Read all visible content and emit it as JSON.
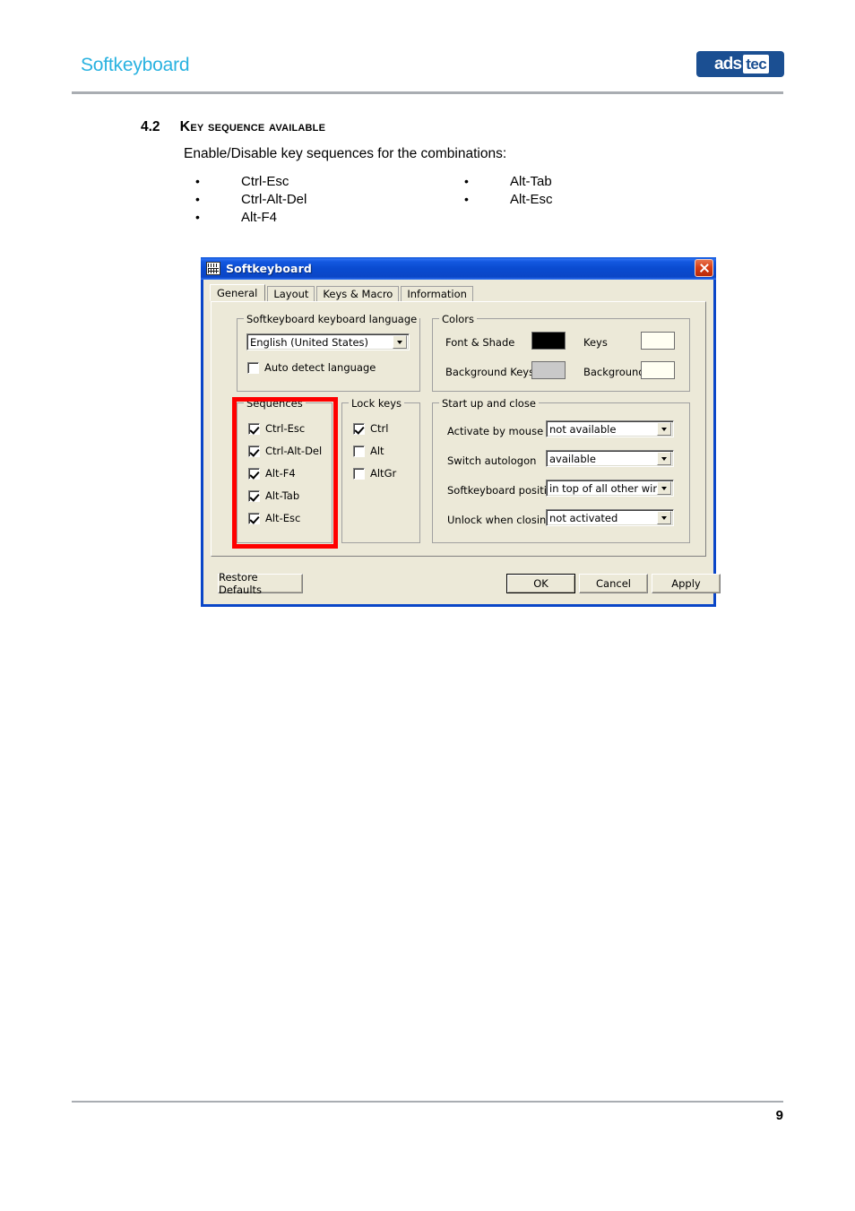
{
  "page": {
    "header_title": "Softkeyboard",
    "logo": {
      "part1": "ads",
      "part2": "tec"
    },
    "page_number": "9",
    "accent_color": "#29b2e0",
    "logo_color": "#1b4f92",
    "rule_color": "#a9adb2"
  },
  "section": {
    "number": "4.2",
    "title": "Key sequence available",
    "intro": "Enable/Disable key sequences for the combinations:",
    "bullets_left": [
      "Ctrl-Esc",
      "Ctrl-Alt-Del",
      "Alt-F4"
    ],
    "bullets_right": [
      "Alt-Tab",
      "Alt-Esc"
    ],
    "bullet_glyph": "•"
  },
  "dialog": {
    "title": "Softkeyboard",
    "icon": "keyboard-icon",
    "close_icon": "close-icon",
    "highlight_color": "#ff0000",
    "titlebar_color": "#0a4bd0",
    "face_color": "#ece9d8",
    "tabs": [
      {
        "label": "General",
        "active": true
      },
      {
        "label": "Layout",
        "active": false
      },
      {
        "label": "Keys & Macro",
        "active": false
      },
      {
        "label": "Information",
        "active": false
      }
    ],
    "language_group": {
      "title": "Softkeyboard keyboard language",
      "combo_value": "English (United States)",
      "auto_detect_label": "Auto detect language",
      "auto_detect_checked": false
    },
    "colors_group": {
      "title": "Colors",
      "items": [
        {
          "label": "Font & Shade",
          "color": "#000000"
        },
        {
          "label": "Keys",
          "color": "#fffff2"
        },
        {
          "label": "Background Keys",
          "color": "#c9c9c9"
        },
        {
          "label": "Background",
          "color": "#fffff2"
        }
      ]
    },
    "sequences_group": {
      "title": "Sequences",
      "items": [
        {
          "label": "Ctrl-Esc",
          "checked": true
        },
        {
          "label": "Ctrl-Alt-Del",
          "checked": true
        },
        {
          "label": "Alt-F4",
          "checked": true
        },
        {
          "label": "Alt-Tab",
          "checked": true
        },
        {
          "label": "Alt-Esc",
          "checked": true
        }
      ]
    },
    "lockkeys_group": {
      "title": "Lock keys",
      "items": [
        {
          "label": "Ctrl",
          "checked": true
        },
        {
          "label": "Alt",
          "checked": false
        },
        {
          "label": "AltGr",
          "checked": false
        }
      ]
    },
    "startup_group": {
      "title": "Start up and close",
      "rows": [
        {
          "label": "Activate by mouse",
          "value": "not available"
        },
        {
          "label": "Switch autologon",
          "value": "available"
        },
        {
          "label": "Softkeyboard position",
          "value": "in top of all other windows"
        },
        {
          "label": "Unlock when closing",
          "value": "not activated"
        }
      ]
    },
    "buttons": {
      "restore": "Restore Defaults",
      "ok": "OK",
      "cancel": "Cancel",
      "apply": "Apply"
    }
  }
}
